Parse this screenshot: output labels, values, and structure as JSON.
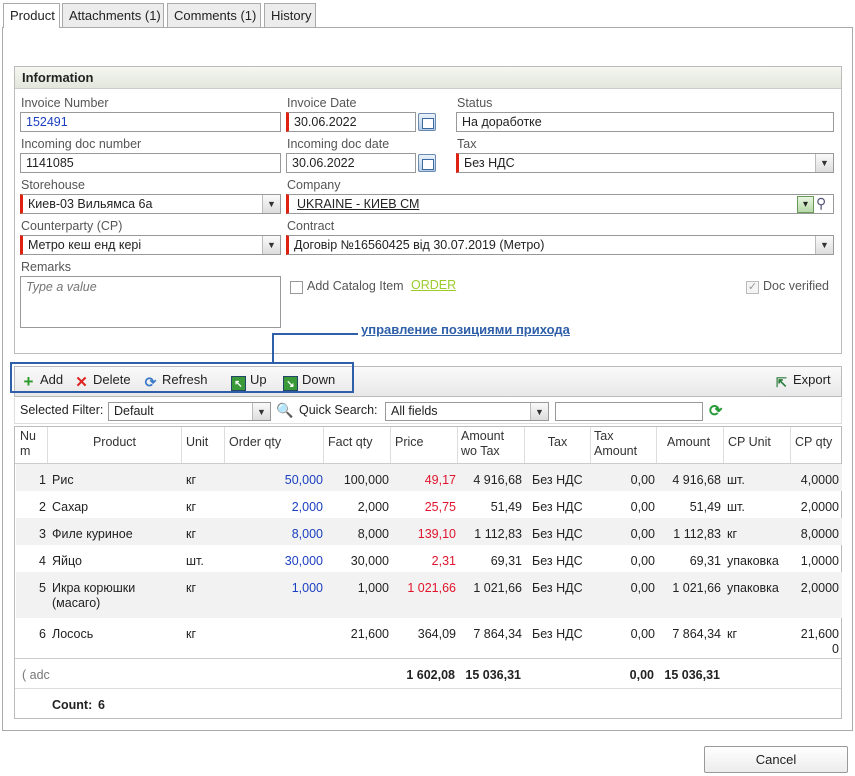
{
  "tabs": [
    "Product",
    "Attachments (1)",
    "Comments (1)",
    "History"
  ],
  "info": {
    "title": "Information",
    "invoice_number_label": "Invoice Number",
    "invoice_number": "152491",
    "invoice_date_label": "Invoice Date",
    "invoice_date": "30.06.2022",
    "status_label": "Status",
    "status": "На доработке",
    "incoming_doc_number_label": "Incoming doc number",
    "incoming_doc_number": "1141085",
    "incoming_doc_date_label": "Incoming doc date",
    "incoming_doc_date": "30.06.2022",
    "tax_label": "Tax",
    "tax": "Без НДС",
    "storehouse_label": "Storehouse",
    "storehouse": "Киев-03 Вильямса 6а",
    "company_label": "Company",
    "company": "UKRAINE - КИЕВ СМ",
    "counterparty_label": "Counterparty (CP)",
    "counterparty": "Метро кеш енд кері",
    "contract_label": "Contract",
    "contract": "Договір №16560425 від 30.07.2019 (Метро)",
    "remarks_label": "Remarks",
    "remarks_placeholder": "Type a value",
    "add_catalog_label": "Add Catalog Item",
    "order_link": "ORDER",
    "doc_verified_label": "Doc verified"
  },
  "annotation": "управление позициями прихода",
  "toolbar": {
    "add": "Add",
    "delete": "Delete",
    "refresh": "Refresh",
    "up": "Up",
    "down": "Down",
    "export": "Export"
  },
  "filter": {
    "selected_label": "Selected Filter:",
    "selected_value": "Default",
    "quick_search_label": "Quick Search:",
    "quick_search_value": "All fields"
  },
  "columns": [
    "Nu m",
    "Product",
    "Unit",
    "Order qty",
    "Fact qty",
    "Price",
    "Amount wo Tax",
    "Tax",
    "Tax Amount",
    "Amount",
    "CP Unit",
    "CP qty"
  ],
  "rows": [
    {
      "num": "1",
      "product": "Рис",
      "unit": "кг",
      "order_qty": "50,000",
      "fact_qty": "100,000",
      "price": "49,17",
      "amount_wo_tax": "4 916,68",
      "tax": "Без НДС",
      "tax_amount": "0,00",
      "amount": "4 916,68",
      "cp_unit": "шт.",
      "cp_qty": "4,0000"
    },
    {
      "num": "2",
      "product": "Сахар",
      "unit": "кг",
      "order_qty": "2,000",
      "fact_qty": "2,000",
      "price": "25,75",
      "amount_wo_tax": "51,49",
      "tax": "Без НДС",
      "tax_amount": "0,00",
      "amount": "51,49",
      "cp_unit": "шт.",
      "cp_qty": "2,0000"
    },
    {
      "num": "3",
      "product": "Филе куриное",
      "unit": "кг",
      "order_qty": "8,000",
      "fact_qty": "8,000",
      "price": "139,10",
      "amount_wo_tax": "1 112,83",
      "tax": "Без НДС",
      "tax_amount": "0,00",
      "amount": "1 112,83",
      "cp_unit": "кг",
      "cp_qty": "8,0000"
    },
    {
      "num": "4",
      "product": "Яйцо",
      "unit": "шт.",
      "order_qty": "30,000",
      "fact_qty": "30,000",
      "price": "2,31",
      "amount_wo_tax": "69,31",
      "tax": "Без НДС",
      "tax_amount": "0,00",
      "amount": "69,31",
      "cp_unit": "упаковка",
      "cp_qty": "1,0000"
    },
    {
      "num": "5",
      "product": "Икра корюшки (масаго)",
      "unit": "кг",
      "order_qty": "1,000",
      "fact_qty": "1,000",
      "price": "1 021,66",
      "amount_wo_tax": "1 021,66",
      "tax": "Без НДС",
      "tax_amount": "0,00",
      "amount": "1 021,66",
      "cp_unit": "упаковка",
      "cp_qty": "2,0000"
    },
    {
      "num": "6",
      "product": "Лосось",
      "unit": "кг",
      "order_qty": "",
      "fact_qty": "21,600",
      "price": "364,09",
      "amount_wo_tax": "7 864,34",
      "tax": "Без НДС",
      "tax_amount": "0,00",
      "amount": "7 864,34",
      "cp_unit": "кг",
      "cp_qty": "21,600 0"
    }
  ],
  "totals": {
    "add_hint": "( adc",
    "price": "1 602,08",
    "amount_wo_tax": "15 036,31",
    "tax_amount": "0,00",
    "amount": "15 036,31"
  },
  "count_label": "Count:",
  "count": "6",
  "cancel": "Cancel"
}
